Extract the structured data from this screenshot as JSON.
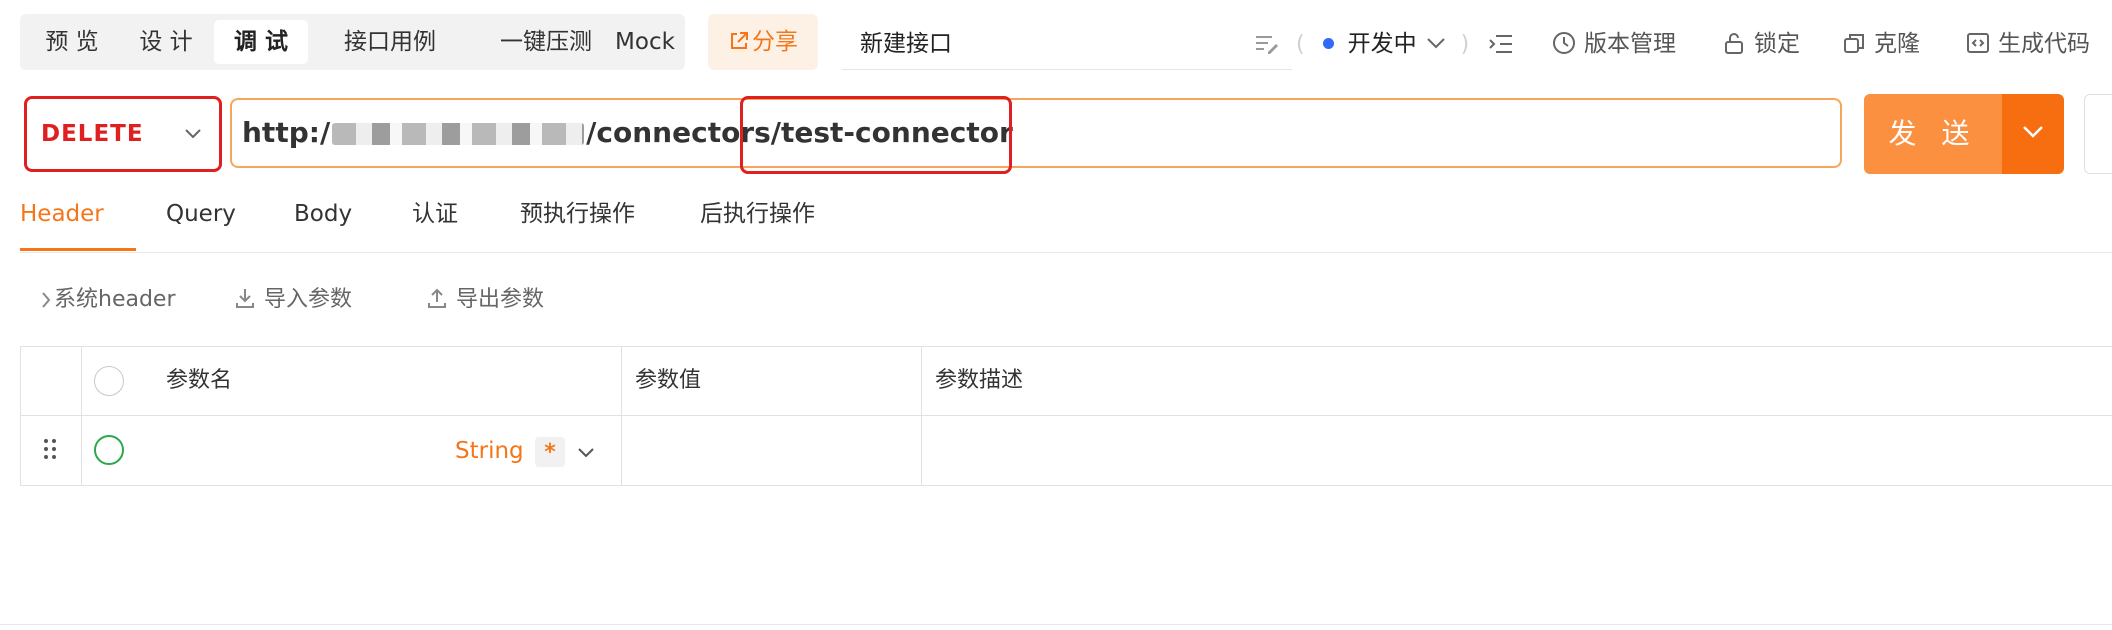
{
  "mode_tabs": [
    "预 览",
    "设 计",
    "调 试",
    "接口用例",
    "一键压测",
    "Mock"
  ],
  "share_label": "分享",
  "api_name": "新建接口",
  "status": "开发中",
  "toolbar": {
    "version_label": "版本管理",
    "lock_label": "锁定",
    "clone_label": "克隆",
    "codegen_label": "生成代码"
  },
  "request": {
    "method": "DELETE",
    "url_prefix": "http:/",
    "url_path": "/connectors/test-connector"
  },
  "send_label": "发 送",
  "req_tabs": [
    "Header",
    "Query",
    "Body",
    "认证",
    "预执行操作",
    "后执行操作"
  ],
  "actions": {
    "system_header": "系统header",
    "import_params": "导入参数",
    "export_params": "导出参数"
  },
  "table": {
    "columns": [
      "参数名",
      "参数值",
      "参数描述"
    ],
    "row": {
      "type": "String",
      "required_mark": "*"
    }
  },
  "colors": {
    "accent": "#f5761a",
    "method": "#e02020",
    "send": "#fb9040",
    "status_dot": "#2f6bf6",
    "enabled_circle": "#2ba84a"
  }
}
